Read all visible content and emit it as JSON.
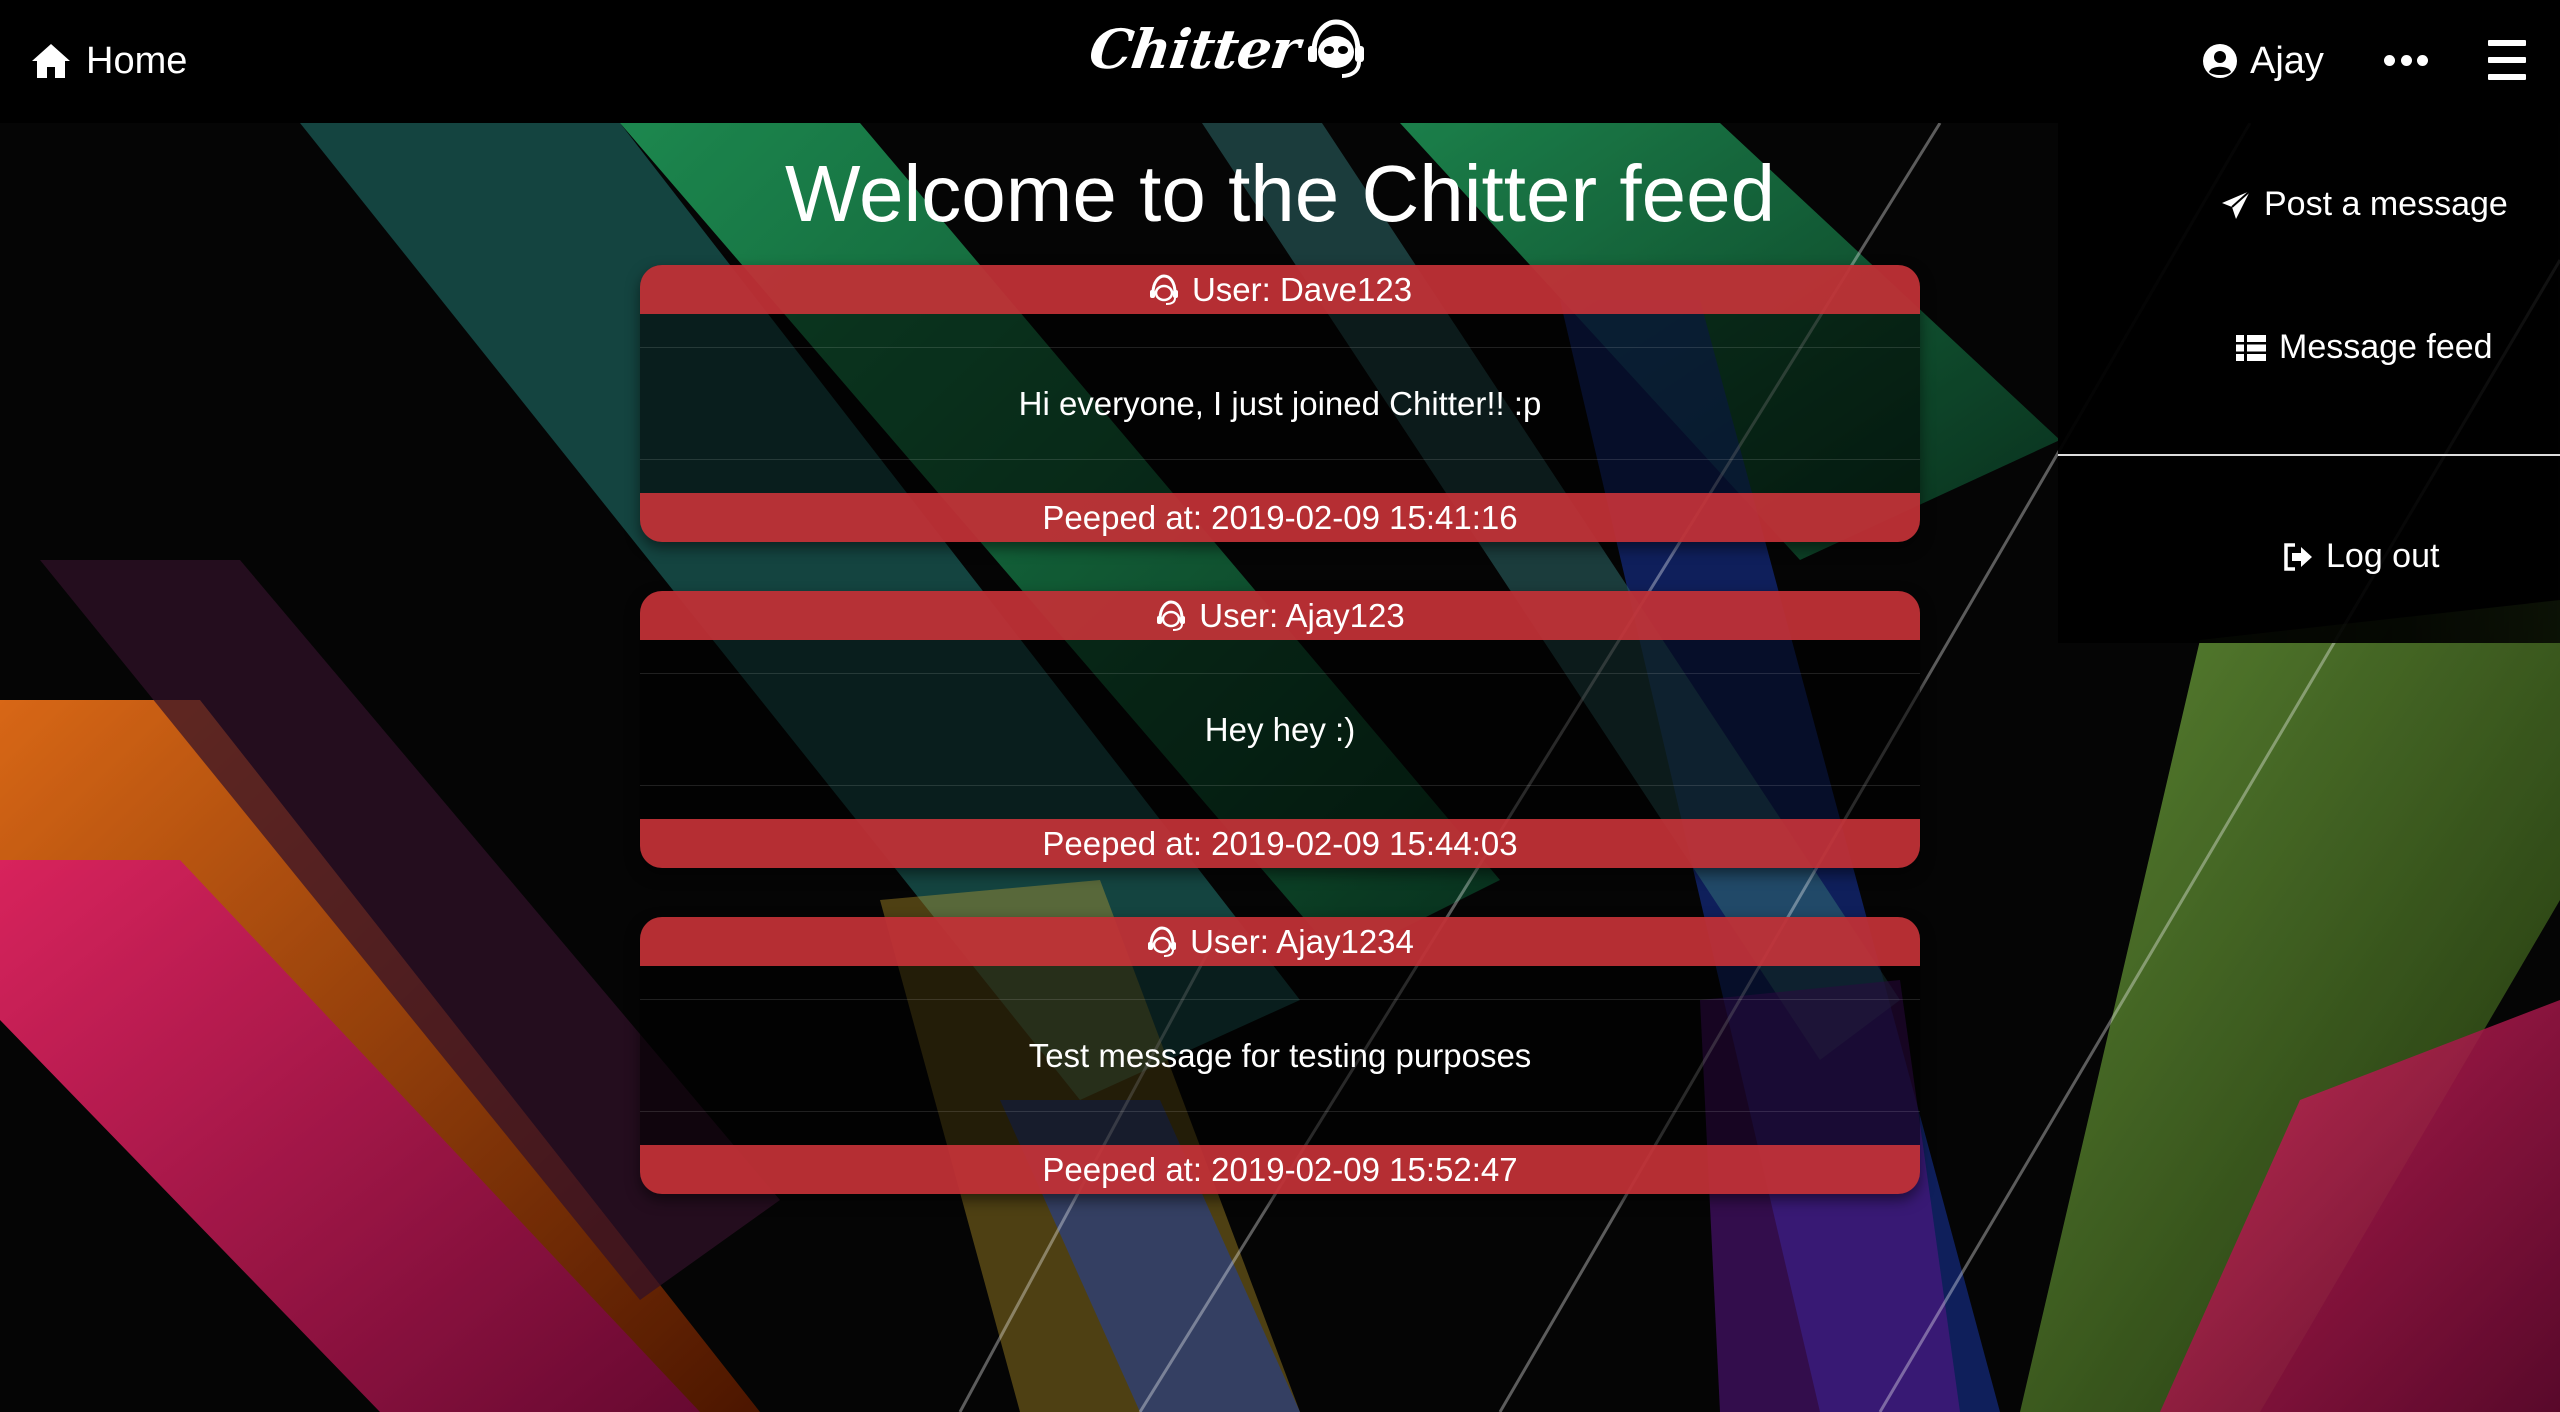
{
  "nav": {
    "home_label": "Home",
    "logo_text": "Chitter",
    "user_label": "Ajay"
  },
  "main": {
    "title": "Welcome to the Chitter feed"
  },
  "peeps": [
    {
      "user": "User: Dave123",
      "message": "Hi everyone, I just joined Chitter!! :p",
      "time": "Peeped at: 2019-02-09 15:41:16"
    },
    {
      "user": "User: Ajay123",
      "message": "Hey hey :)",
      "time": "Peeped at: 2019-02-09 15:44:03"
    },
    {
      "user": "User: Ajay1234",
      "message": "Test message for testing purposes",
      "time": "Peeped at: 2019-02-09 15:52:47"
    }
  ],
  "side_menu": {
    "post_label": "Post a message",
    "feed_label": "Message feed",
    "logout_label": "Log out"
  },
  "colors": {
    "peep_bar": "#ce343a",
    "background": "#000000",
    "text": "#ffffff"
  },
  "icons": {
    "home": "home-icon",
    "logo": "headset-icon",
    "user": "user-circle-icon",
    "more": "ellipsis-icon",
    "menu": "hamburger-icon",
    "peep_user": "headset-icon",
    "post": "paper-plane-icon",
    "feed": "list-icon",
    "logout": "sign-out-icon"
  }
}
